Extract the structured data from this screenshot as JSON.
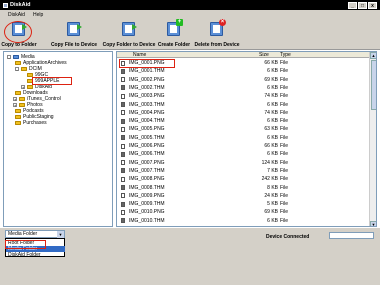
{
  "window": {
    "title": "DiskAid",
    "min": "_",
    "max": "□",
    "close": "x"
  },
  "menu": [
    "DiskAid",
    "Help"
  ],
  "toolbar": {
    "copy_to_folder": "Copy to Folder",
    "copy_file_to_device": "Copy File to Device",
    "copy_folder_to_device": "Copy Folder to Device",
    "create_folder": "Create Folder",
    "delete_from_device": "Delete from Device"
  },
  "tree": [
    {
      "label": "Media",
      "level": 0,
      "expander": "-",
      "icon": "blue-folder"
    },
    {
      "label": "ApplicationArchives",
      "level": 1,
      "expander": "",
      "icon": "folder"
    },
    {
      "label": "DCIM",
      "level": 1,
      "expander": "-",
      "icon": "folder"
    },
    {
      "label": "99GC",
      "level": 2,
      "expander": "",
      "icon": "folder"
    },
    {
      "label": "999APPLE",
      "level": 2,
      "expander": "",
      "icon": "folder"
    },
    {
      "label": "DiskAid",
      "level": 2,
      "expander": "+",
      "icon": "folder"
    },
    {
      "label": "Downloads",
      "level": 1,
      "expander": "",
      "icon": "folder"
    },
    {
      "label": "iTunes_Control",
      "level": 1,
      "expander": "+",
      "icon": "folder"
    },
    {
      "label": "Photos",
      "level": 1,
      "expander": "+",
      "icon": "folder"
    },
    {
      "label": "Podcasts",
      "level": 1,
      "expander": "",
      "icon": "folder"
    },
    {
      "label": "PublicStaging",
      "level": 1,
      "expander": "",
      "icon": "folder"
    },
    {
      "label": "Purchases",
      "level": 1,
      "expander": "",
      "icon": "folder"
    }
  ],
  "list": {
    "headers": {
      "name": "Name",
      "size": "Size",
      "type": "Type"
    },
    "rows": [
      {
        "name": "IMG_0001.PNG",
        "size": "66 KB",
        "type": "File",
        "kind": "png"
      },
      {
        "name": "IMG_0001.THM",
        "size": "6 KB",
        "type": "File",
        "kind": "thm"
      },
      {
        "name": "IMG_0002.PNG",
        "size": "69 KB",
        "type": "File",
        "kind": "png"
      },
      {
        "name": "IMG_0002.THM",
        "size": "6 KB",
        "type": "File",
        "kind": "thm"
      },
      {
        "name": "IMG_0003.PNG",
        "size": "74 KB",
        "type": "File",
        "kind": "png"
      },
      {
        "name": "IMG_0003.THM",
        "size": "6 KB",
        "type": "File",
        "kind": "thm"
      },
      {
        "name": "IMG_0004.PNG",
        "size": "74 KB",
        "type": "File",
        "kind": "png"
      },
      {
        "name": "IMG_0004.THM",
        "size": "6 KB",
        "type": "File",
        "kind": "thm"
      },
      {
        "name": "IMG_0005.PNG",
        "size": "63 KB",
        "type": "File",
        "kind": "png"
      },
      {
        "name": "IMG_0005.THM",
        "size": "6 KB",
        "type": "File",
        "kind": "thm"
      },
      {
        "name": "IMG_0006.PNG",
        "size": "66 KB",
        "type": "File",
        "kind": "png"
      },
      {
        "name": "IMG_0006.THM",
        "size": "6 KB",
        "type": "File",
        "kind": "thm"
      },
      {
        "name": "IMG_0007.PNG",
        "size": "124 KB",
        "type": "File",
        "kind": "png"
      },
      {
        "name": "IMG_0007.THM",
        "size": "7 KB",
        "type": "File",
        "kind": "thm"
      },
      {
        "name": "IMG_0008.PNG",
        "size": "242 KB",
        "type": "File",
        "kind": "png"
      },
      {
        "name": "IMG_0008.THM",
        "size": "8 KB",
        "type": "File",
        "kind": "thm"
      },
      {
        "name": "IMG_0009.PNG",
        "size": "24 KB",
        "type": "File",
        "kind": "png"
      },
      {
        "name": "IMG_0009.THM",
        "size": "5 KB",
        "type": "File",
        "kind": "thm"
      },
      {
        "name": "IMG_0010.PNG",
        "size": "69 KB",
        "type": "File",
        "kind": "png"
      },
      {
        "name": "IMG_0010.THM",
        "size": "6 KB",
        "type": "File",
        "kind": "thm"
      }
    ]
  },
  "bottom": {
    "combo_value": "Media Folder",
    "combo_arrow": "▼",
    "options": [
      "Root Folder",
      "Media Folder",
      "DiskAid Folder"
    ],
    "selected_option": 1,
    "status_label": "Device Connected"
  },
  "scrollbar": {
    "up": "▲",
    "down": "▼"
  }
}
